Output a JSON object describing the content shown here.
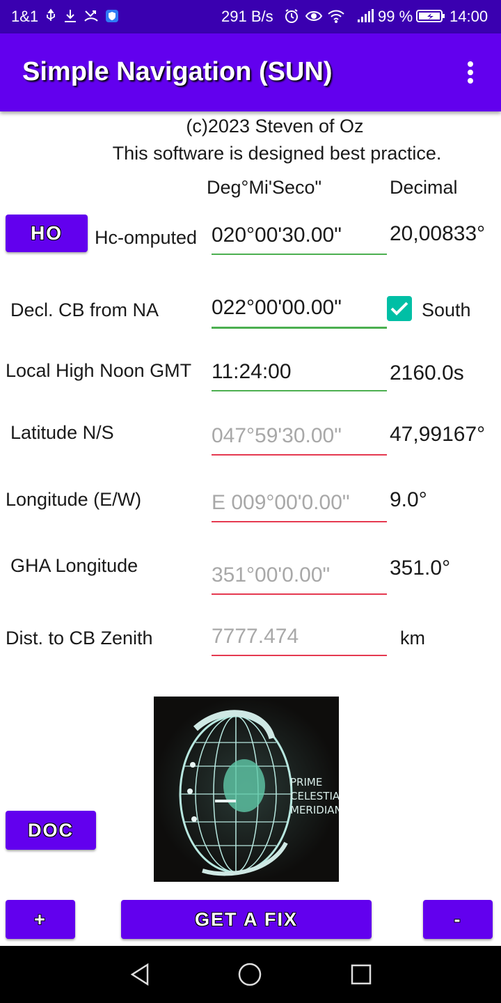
{
  "status_bar": {
    "left_text": "1&1",
    "net_speed": "291 B/s",
    "battery": "99 %",
    "time": "14:00",
    "icons": [
      "usb-icon",
      "download-icon",
      "missed-call-icon",
      "shield-icon",
      "alarm-icon",
      "eye-icon",
      "wifi-icon",
      "signal-icon",
      "battery-icon"
    ]
  },
  "app_bar": {
    "title": "Simple Navigation (SUN)",
    "menu_icon": "more-vert-icon"
  },
  "header": {
    "copyright": "(c)2023 Steven of Oz",
    "tagline": "This software is designed best practice.",
    "col_dms": "Deg°Mi'Seco\"",
    "col_decimal": "Decimal"
  },
  "rows": {
    "ho_button": "HO",
    "hc_label": "Hc-omputed",
    "hc_value": "020°00'30.00\"",
    "hc_decimal": "20,00833°",
    "decl_label": "Decl. CB from NA",
    "decl_value": "022°00'00.00\"",
    "south_label": "South",
    "south_checked": true,
    "noon_label": "Local High Noon GMT",
    "noon_value": "11:24:00",
    "noon_seconds": "2160.0s",
    "lat_label": "Latitude N/S",
    "lat_value": "047°59'30.00\"",
    "lat_decimal": "47,99167°",
    "lon_label": "Longitude (E/W)",
    "lon_value": "E 009°00'0.00\"",
    "lon_decimal": "9.0°",
    "gha_label": "GHA Longitude",
    "gha_value": "351°00'0.00\"",
    "gha_decimal": "351.0°",
    "dist_label": "Dist. to CB Zenith",
    "dist_value": "7777.474",
    "dist_unit": "km"
  },
  "globe_text": [
    "PRIME",
    "CELESTIAL",
    "MERIDIAN"
  ],
  "buttons": {
    "doc": "DOC",
    "plus": "+",
    "fix": "GET A FIX",
    "minus": "-"
  },
  "colors": {
    "app_bar": "#6200ee",
    "status_bar": "#3a00b0",
    "valid_underline": "#4caf50",
    "invalid_underline": "#e53950",
    "checkbox": "#00bfa5"
  }
}
